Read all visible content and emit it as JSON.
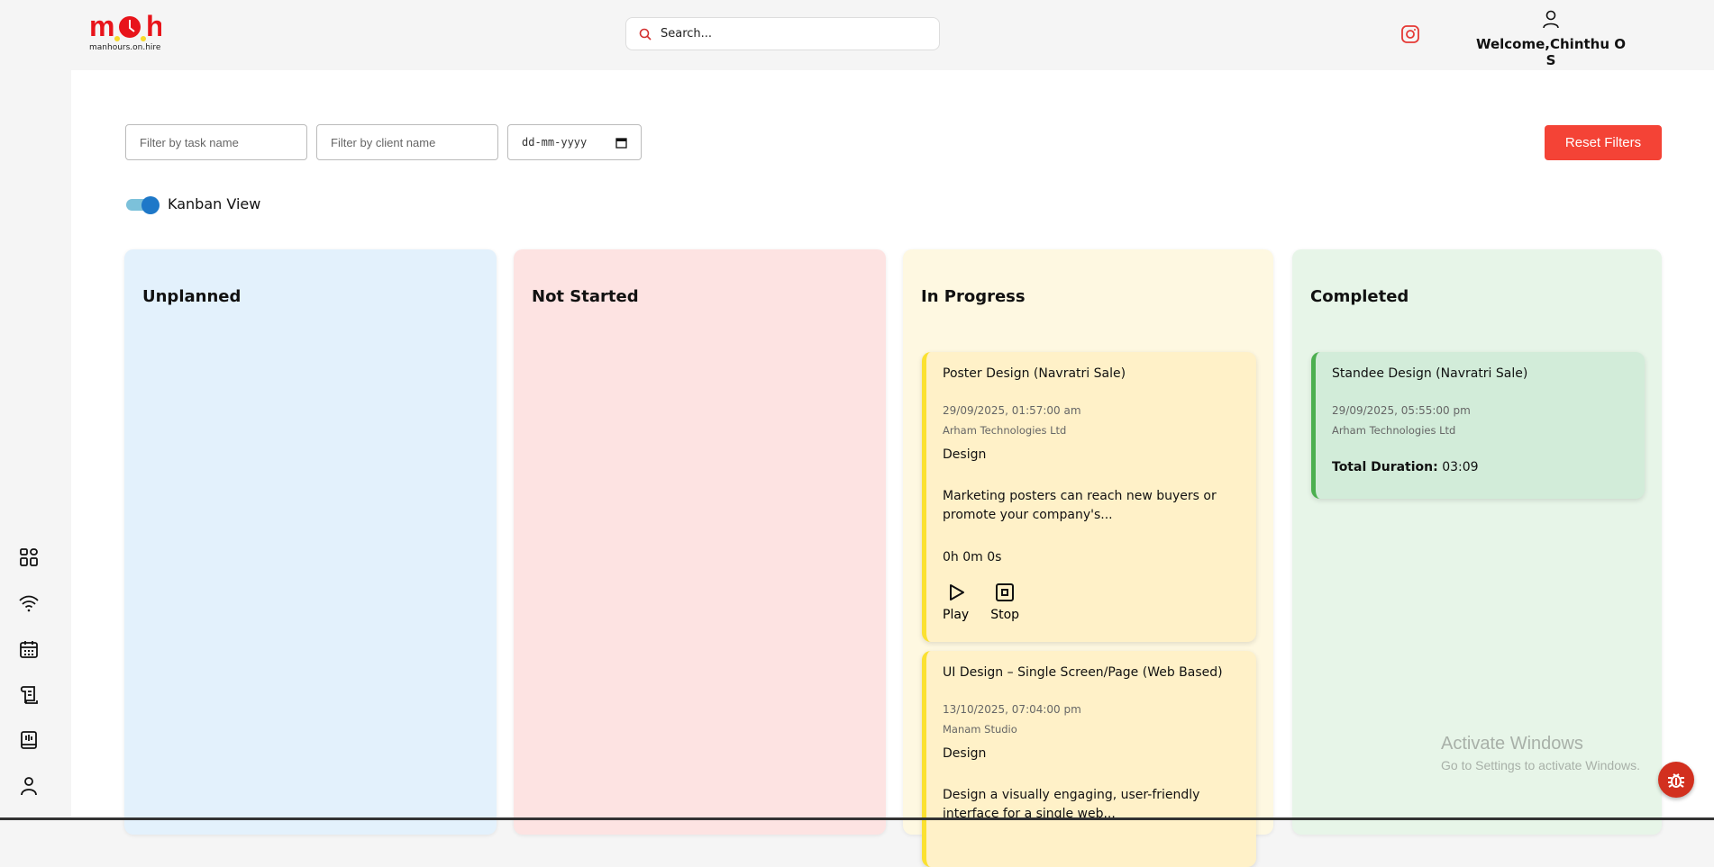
{
  "header": {
    "logo_text": "m.o.h",
    "logo_tagline": "manhours.on.hire",
    "search_placeholder": "Search...",
    "welcome": "Welcome,Chinthu O S"
  },
  "sidebar": {
    "items": [
      {
        "icon": "dashboard-icon"
      },
      {
        "icon": "wifi-icon"
      },
      {
        "icon": "calendar-icon"
      },
      {
        "icon": "scroll-icon"
      },
      {
        "icon": "report-book-icon"
      },
      {
        "icon": "user-icon"
      }
    ]
  },
  "filters": {
    "task_placeholder": "Filter by task name",
    "client_placeholder": "Filter by client name",
    "date_placeholder": "dd-mm-yyyy",
    "reset_label": "Reset Filters"
  },
  "view_toggle": {
    "label": "Kanban View",
    "on": true
  },
  "colors": {
    "accent": "#1e78c8",
    "reset": "#f44336",
    "unplanned": "#e3f1fc",
    "not_started": "#fde3e2",
    "in_progress": "#fef8e1",
    "completed": "#e7f5e8",
    "progress_bar": "#fbe131",
    "completed_bar": "#4caf50"
  },
  "columns": [
    {
      "title": "Unplanned",
      "cards": []
    },
    {
      "title": "Not Started",
      "cards": []
    },
    {
      "title": "In Progress",
      "cards": [
        {
          "title": "Poster Design (Navratri Sale)",
          "date": "29/09/2025, 01:57:00 am",
          "client": "Arham Technologies Ltd",
          "category": "Design",
          "description": "Marketing posters can reach new buyers or promote your company's...",
          "timer": "0h 0m 0s",
          "play": "Play",
          "stop": "Stop"
        },
        {
          "title": "UI Design – Single Screen/Page (Web Based)",
          "date": "13/10/2025, 07:04:00 pm",
          "client": "Manam Studio",
          "category": "Design",
          "description": "Design a visually engaging, user-friendly interface for a single web..."
        }
      ]
    },
    {
      "title": "Completed",
      "cards": [
        {
          "title": "Standee Design (Navratri Sale)",
          "date": "29/09/2025, 05:55:00 pm",
          "client": "Arham Technologies Ltd",
          "total_label": "Total Duration:",
          "total_value": "03:09"
        }
      ]
    }
  ],
  "overlay": {
    "line1": "Activate Windows",
    "line2": "Go to Settings to activate Windows."
  }
}
